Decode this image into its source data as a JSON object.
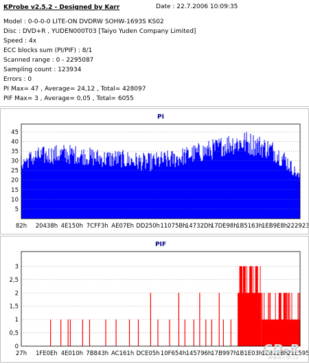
{
  "info": {
    "title": "KProbe v2.5.2 - Designed by Karr",
    "date": "Date : 22.7.2006 10:09:35",
    "lines": [
      "Model : 0-0-0-0 LITE-ON DVDRW SOHW-1693S KS02",
      "Disc : DVD+R , YUDEN000T03 [Taiyo Yuden Company Limited]",
      "Speed : 4x",
      "ECC blocks sum (PI/PIF) : 8/1",
      "Scanned range : 0 - 2295087",
      "Sampling count : 123934",
      "Errors : 0",
      "PI Max= 47 , Average= 24,12 , Total= 428097",
      "PIF Max= 3 , Average= 0,05 , Total= 6055"
    ]
  },
  "watermark": {
    "logo": "CD-R",
    "url": "www.cdr.cz"
  },
  "chart_data": [
    {
      "type": "area",
      "title": "PI",
      "color": "#0000ff",
      "x_tick_labels": [
        "82h",
        "20438h",
        "4E150h",
        "7CFF3h",
        "AE07Eh",
        "DD250h",
        "11075Bh",
        "14732Dh",
        "17DE98h",
        "1B5163h",
        "1EB9E8h",
        "222923h"
      ],
      "y_ticks": [
        5,
        10,
        15,
        20,
        25,
        30,
        35,
        40,
        45
      ],
      "ylim": [
        0,
        49
      ],
      "xlim": [
        0,
        100
      ],
      "x_sample_percent": [
        0,
        5,
        10,
        15,
        20,
        25,
        30,
        35,
        40,
        45,
        50,
        55,
        60,
        65,
        70,
        75,
        80,
        85,
        90,
        95,
        100
      ],
      "baseline": [
        25,
        27,
        28,
        28,
        28,
        27,
        26,
        26,
        25,
        24,
        25,
        26,
        28,
        29,
        31,
        33,
        33,
        32,
        30,
        25,
        19
      ],
      "peaks": [
        33,
        37,
        38,
        39,
        38,
        37,
        36,
        36,
        35,
        34,
        35,
        36,
        38,
        40,
        42,
        45,
        46,
        44,
        41,
        35,
        23
      ]
    },
    {
      "type": "bar",
      "title": "PIF",
      "color": "#ff0000",
      "x_tick_labels": [
        "27h",
        "1FE0Eh",
        "4E010h",
        "7B843h",
        "AC161h",
        "DCE05h",
        "10F654h",
        "145796h",
        "17B997h",
        "1B1E03h",
        "1E812Bh",
        "21E595h"
      ],
      "y_ticks": [
        0,
        0.5,
        1,
        1.5,
        2,
        2.5,
        3
      ],
      "ylim": [
        0,
        3
      ],
      "xlim": [
        0,
        100
      ],
      "bars": [
        {
          "x": 10.5,
          "v": 1
        },
        {
          "x": 14.2,
          "v": 1
        },
        {
          "x": 16.8,
          "v": 1
        },
        {
          "x": 17.6,
          "v": 1
        },
        {
          "x": 22.0,
          "v": 1
        },
        {
          "x": 24.5,
          "v": 1
        },
        {
          "x": 30.3,
          "v": 1
        },
        {
          "x": 34.0,
          "v": 1
        },
        {
          "x": 38.8,
          "v": 1
        },
        {
          "x": 42.0,
          "v": 1
        },
        {
          "x": 46.4,
          "v": 2
        },
        {
          "x": 49.0,
          "v": 1
        },
        {
          "x": 53.2,
          "v": 1
        },
        {
          "x": 56.5,
          "v": 2
        },
        {
          "x": 58.7,
          "v": 1
        },
        {
          "x": 61.9,
          "v": 1
        },
        {
          "x": 64.0,
          "v": 2
        },
        {
          "x": 66.2,
          "v": 1
        },
        {
          "x": 68.3,
          "v": 1
        },
        {
          "x": 71.0,
          "v": 2
        },
        {
          "x": 72.5,
          "v": 1
        },
        {
          "x": 75.2,
          "v": 1
        },
        {
          "x": 81.3,
          "v": 2
        }
      ],
      "dense_regions": [
        {
          "x0": 77.6,
          "x1": 86.0,
          "v": 2,
          "peaks": [
            {
              "x": 78.8,
              "v": 3
            },
            {
              "x": 80.0,
              "v": 3
            },
            {
              "x": 82.3,
              "v": 3
            },
            {
              "x": 84.4,
              "v": 3
            }
          ]
        },
        {
          "x0": 86.0,
          "x1": 91.5,
          "v": 1
        },
        {
          "x0": 91.5,
          "x1": 100.0,
          "v": 1,
          "peaks": [
            {
              "x": 92.8,
              "v": 2
            },
            {
              "x": 94.5,
              "v": 2
            }
          ]
        }
      ]
    }
  ]
}
